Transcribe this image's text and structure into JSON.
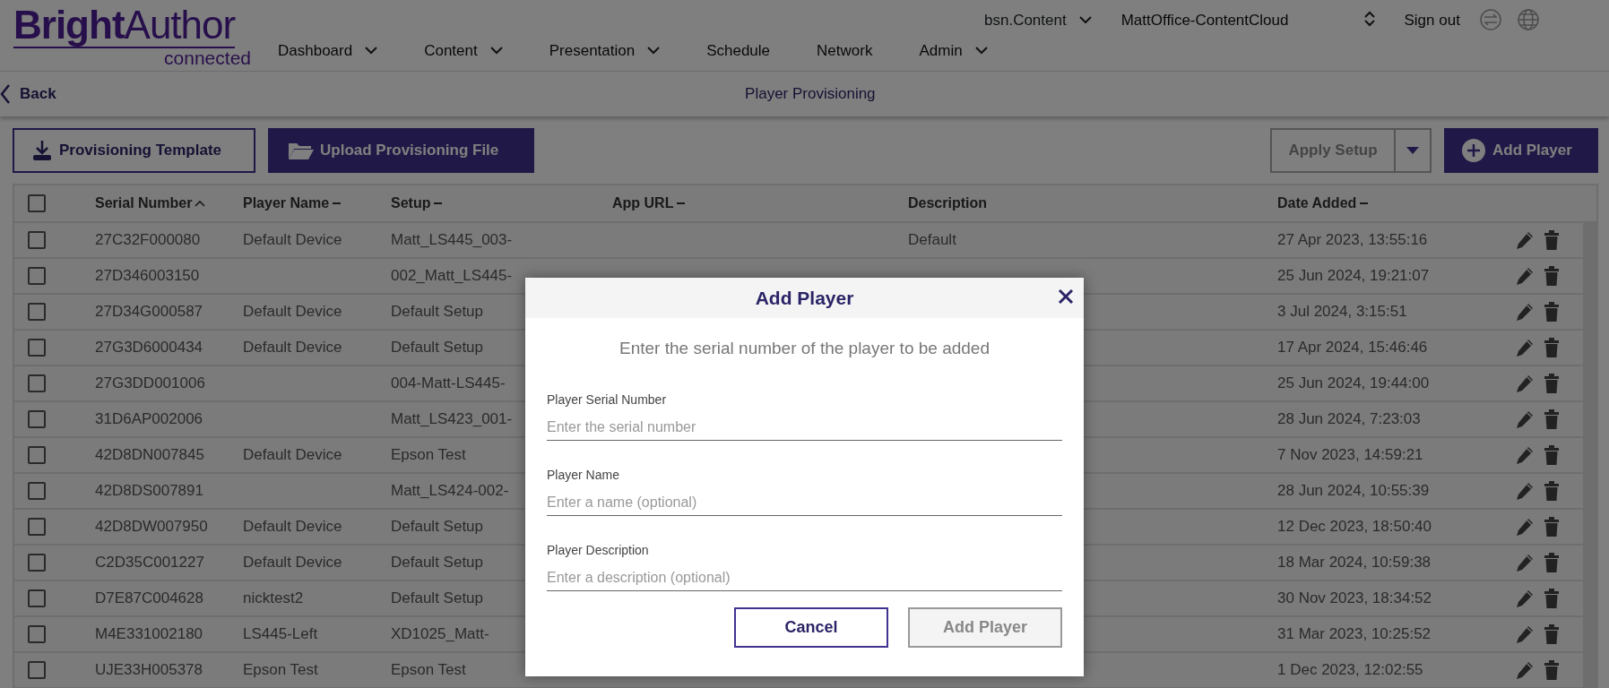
{
  "app": {
    "logo": "**Bright**Author",
    "logo_sub": "connected",
    "nav": [
      {
        "label": "Dashboard",
        "dropdown": true
      },
      {
        "label": "Content",
        "dropdown": true
      },
      {
        "label": "Presentation",
        "dropdown": true
      },
      {
        "label": "Schedule",
        "dropdown": false
      },
      {
        "label": "Network",
        "dropdown": false
      },
      {
        "label": "Admin",
        "dropdown": true
      }
    ],
    "account": "bsn.Content",
    "network": "MattOffice-ContentCloud",
    "sign_out": "Sign out"
  },
  "page": {
    "back": "Back",
    "title": "Player Provisioning"
  },
  "toolbar": {
    "template": "Provisioning Template",
    "upload": "Upload Provisioning File",
    "apply_setup": "Apply Setup",
    "add_player": "Add Player"
  },
  "table": {
    "select_all": false,
    "columns": [
      {
        "label": "Serial Number",
        "sortable": true,
        "sorted": true
      },
      {
        "label": "Player Name",
        "sortable": true,
        "sorted": false
      },
      {
        "label": "Setup",
        "sortable": true,
        "sorted": false
      },
      {
        "label": "App URL",
        "sortable": true,
        "sorted": false
      },
      {
        "label": "Description",
        "sortable": false,
        "sorted": false
      },
      {
        "label": "Date Added",
        "sortable": true,
        "sorted": false
      }
    ],
    "rows": [
      {
        "checked": false,
        "serial": "27C32F000080",
        "player_name": "Default Device",
        "setup": "Matt_LS445_003-",
        "description": "Default",
        "date_added": "27 Apr 2023, 13:55:16"
      },
      {
        "checked": false,
        "serial": "27D346003150",
        "setup": "002_Matt_LS445-",
        "date_added": "25 Jun 2024, 19:21:07"
      },
      {
        "checked": false,
        "serial": "27D34G000587",
        "player_name": "Default Device",
        "setup": "Default Setup",
        "date_added": "3 Jul 2024, 3:15:51"
      },
      {
        "checked": false,
        "serial": "27G3D6000434",
        "player_name": "Default Device",
        "setup": "Default Setup",
        "date_added": "17 Apr 2024, 15:46:46"
      },
      {
        "checked": false,
        "serial": "27G3DD001006",
        "setup": "004-Matt-LS445-",
        "date_added": "25 Jun 2024, 19:44:00"
      },
      {
        "checked": false,
        "serial": "31D6AP002006",
        "setup": "Matt_LS423_001-",
        "date_added": "28 Jun 2024, 7:23:03"
      },
      {
        "checked": false,
        "serial": "42D8DN007845",
        "player_name": "Default Device",
        "setup": "Epson Test",
        "date_added": "7 Nov 2023, 14:59:21"
      },
      {
        "checked": false,
        "serial": "42D8DS007891",
        "setup": "Matt_LS424-002-",
        "date_added": "28 Jun 2024, 10:55:39"
      },
      {
        "checked": false,
        "serial": "42D8DW007950",
        "player_name": "Default Device",
        "setup": "Default Setup",
        "date_added": "12 Dec 2023, 18:50:40"
      },
      {
        "checked": false,
        "serial": "C2D35C001227",
        "player_name": "Default Device",
        "setup": "Default Setup",
        "date_added": "18 Mar 2024, 10:59:38"
      },
      {
        "checked": false,
        "serial": "D7E87C004628",
        "player_name": "nicktest2",
        "setup": "Default Setup",
        "date_added": "30 Nov 2023, 18:34:52"
      },
      {
        "checked": false,
        "serial": "M4E331002180",
        "player_name": "LS445-Left",
        "setup": "XD1025_Matt-",
        "date_added": "31 Mar 2023, 10:25:52"
      },
      {
        "checked": false,
        "serial": "UJE33H005378",
        "player_name": "Epson Test",
        "setup": "Epson Test",
        "date_added": "1 Dec 2023, 12:02:55"
      }
    ]
  },
  "dialog": {
    "title": "Add Player",
    "intro": "Enter the serial number of the player to be added",
    "fields": [
      {
        "label": "Player Serial Number",
        "placeholder": "Enter the serial number"
      },
      {
        "label": "Player Name",
        "placeholder": "Enter a name (optional)"
      },
      {
        "label": "Player Description",
        "placeholder": "Enter a description (optional)"
      }
    ],
    "buttons": [
      {
        "label": "Cancel",
        "kind": "secondary",
        "disabled": false
      },
      {
        "label": "Add Player",
        "kind": "primary",
        "disabled": true
      }
    ]
  }
}
